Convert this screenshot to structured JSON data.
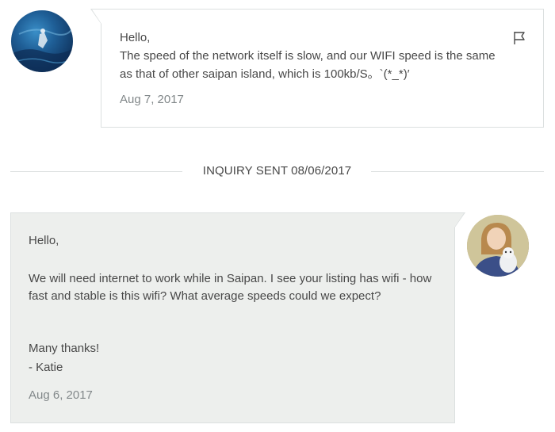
{
  "messages": [
    {
      "sender": "host",
      "greeting": "Hello,",
      "body": "The speed of the network itself is slow, and our WIFI speed is the same as that of other saipan island, which is 100kb/S。`(*_*)′",
      "date": "Aug 7, 2017",
      "icons": {
        "avatar": "host-avatar-ocean-photo",
        "action": "flag-icon"
      }
    },
    {
      "sender": "guest",
      "greeting": "Hello,",
      "body": "We will need internet to work while in Saipan.  I see your listing has wifi - how fast and stable is this wifi?  What average speeds could we expect?",
      "closing": "Many thanks!",
      "signature": "- Katie",
      "date": "Aug 6, 2017",
      "icons": {
        "avatar": "guest-avatar-photo"
      }
    }
  ],
  "divider": {
    "label": "INQUIRY SENT 08/06/2017"
  },
  "colors": {
    "text": "#484848",
    "muted": "#82888a",
    "border": "#dce0e0",
    "guest_bubble_bg": "#edefed",
    "host_bubble_bg": "#ffffff"
  }
}
